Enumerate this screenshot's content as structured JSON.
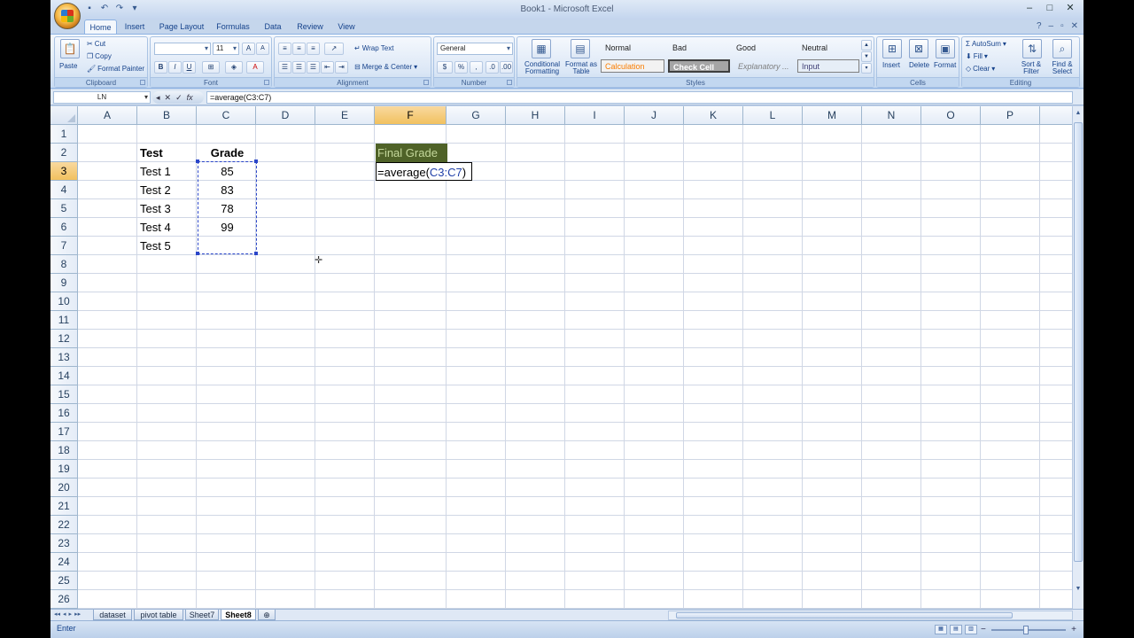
{
  "window": {
    "title": "Book1 - Microsoft Excel",
    "controls": [
      "–",
      "□",
      "✕"
    ]
  },
  "ribbon_tabs": [
    "Home",
    "Insert",
    "Page Layout",
    "Formulas",
    "Data",
    "Review",
    "View"
  ],
  "ribbon": {
    "clipboard": {
      "label": "Clipboard",
      "paste": "Paste",
      "cut": "Cut",
      "copy": "Copy",
      "format_painter": "Format Painter"
    },
    "font": {
      "label": "Font",
      "font_name": "",
      "font_size": "11"
    },
    "alignment": {
      "label": "Alignment",
      "wrap_text": "Wrap Text",
      "merge_center": "Merge & Center"
    },
    "number": {
      "label": "Number",
      "format": "General"
    },
    "styles": {
      "label": "Styles",
      "conditional": "Conditional Formatting",
      "format_table": "Format as Table",
      "cells": [
        "Normal",
        "Bad",
        "Good",
        "Neutral",
        "Calculation",
        "Check Cell",
        "Explanatory ...",
        "Input"
      ]
    },
    "cells": {
      "label": "Cells",
      "insert": "Insert",
      "delete": "Delete",
      "format": "Format"
    },
    "editing": {
      "label": "Editing",
      "autosum": "AutoSum",
      "fill": "Fill",
      "clear": "Clear",
      "sort_filter": "Sort & Filter",
      "find_select": "Find & Select"
    }
  },
  "formula_bar": {
    "name_box": "LN",
    "formula": "=average(C3:C7)"
  },
  "columns": [
    "A",
    "B",
    "C",
    "D",
    "E",
    "F",
    "G",
    "H",
    "I",
    "J",
    "K",
    "L",
    "M",
    "N",
    "O",
    "P"
  ],
  "rows": [
    "1",
    "2",
    "3",
    "4",
    "5",
    "6",
    "7",
    "8",
    "9",
    "10",
    "11",
    "12",
    "13",
    "14",
    "15",
    "16",
    "17",
    "18",
    "19",
    "20",
    "21",
    "22",
    "23",
    "24",
    "25",
    "26"
  ],
  "cells": {
    "B2": "Test",
    "C2": "Grade",
    "B3": "Test 1",
    "C3": "85",
    "B4": "Test 2",
    "C4": "83",
    "B5": "Test 3",
    "C5": "78",
    "B6": "Test 4",
    "C6": "99",
    "B7": "Test 5",
    "F2": "Final Grade",
    "F3_prefix": "=average(",
    "F3_ref": "C3:C7",
    "F3_suffix": ")"
  },
  "sheets": [
    "dataset",
    "pivot table",
    "Sheet7",
    "Sheet8"
  ],
  "active_sheet": "Sheet8",
  "status": {
    "mode": "Enter"
  },
  "colors": {
    "final_grade_fill": "#4f6228",
    "final_grade_text": "#c4d79b",
    "reference_blue": "#1f3fa8",
    "selected_header": "#f1c15f"
  }
}
